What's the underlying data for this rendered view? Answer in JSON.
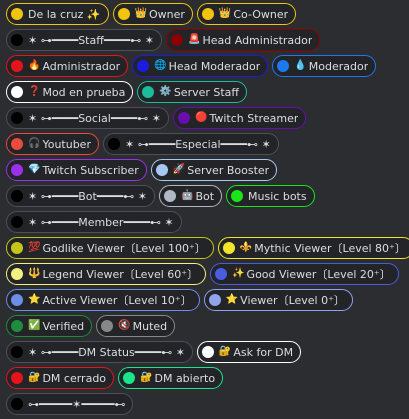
{
  "rows": [
    {
      "roles": [
        {
          "name": "De la cruz ✨",
          "emoji": "",
          "color": "#f1c40f"
        },
        {
          "name": "Owner",
          "emoji": "👑",
          "color": "#f1c40f"
        },
        {
          "name": "Co-Owner",
          "emoji": "👑",
          "color": "#f1c40f"
        }
      ]
    },
    {
      "roles": [
        {
          "name": "✶ ⊶━━━━Staff━━━━⊷ ✶",
          "emoji": "",
          "color": "#000000"
        },
        {
          "name": "Head Administrador",
          "emoji": "🚨",
          "color": "#8b0000"
        }
      ]
    },
    {
      "roles": [
        {
          "name": "Administrador",
          "emoji": "🔥",
          "color": "#e5141b"
        },
        {
          "name": "Head Moderador",
          "emoji": "🌐",
          "color": "#1c1ce0"
        },
        {
          "name": "Moderador",
          "emoji": "💧",
          "color": "#1e78f0"
        }
      ]
    },
    {
      "roles": [
        {
          "name": "Mod en prueba",
          "emoji": "❓",
          "color": "#ffffff"
        },
        {
          "name": "Server Staff",
          "emoji": "⚙️",
          "color": "#1abc9c"
        }
      ]
    },
    {
      "roles": [
        {
          "name": "✶ ⊶━━━━Social━━━━⊷ ✶",
          "emoji": "",
          "color": "#000000"
        },
        {
          "name": "Twitch Streamer",
          "emoji": "🔴",
          "color": "#6a0dad"
        }
      ]
    },
    {
      "roles": [
        {
          "name": "Youtuber",
          "emoji": "🎧",
          "color": "#e74c3c"
        },
        {
          "name": "✶ ⊶━━━━Especial━━━━⊷ ✶",
          "emoji": "",
          "color": "#000000"
        }
      ]
    },
    {
      "roles": [
        {
          "name": "Twitch Subscriber",
          "emoji": "💎",
          "color": "#9b30e8"
        },
        {
          "name": "Server Booster",
          "emoji": "🚀",
          "color": "#a4c8f0"
        }
      ]
    },
    {
      "roles": [
        {
          "name": "✶ ⊶━━━━Bot━━━━⊷ ✶",
          "emoji": "",
          "color": "#000000"
        },
        {
          "name": "Bot",
          "emoji": "🤖",
          "color": "#b0b8c4"
        },
        {
          "name": "Music bots",
          "emoji": "",
          "color": "#19e619"
        }
      ]
    },
    {
      "roles": [
        {
          "name": "✶ ⊶━━━━Member━━━━⊷ ✶",
          "emoji": "",
          "color": "#000000"
        }
      ]
    },
    {
      "roles": [
        {
          "name": "Godlike Viewer〔Level 100⁺〕",
          "emoji": "💯",
          "color": "#c6c61a"
        },
        {
          "name": "Mythic Viewer〔Level 80⁺〕",
          "emoji": "⚜️",
          "color": "#f2e42a"
        }
      ]
    },
    {
      "roles": [
        {
          "name": "Legend Viewer〔Level 60⁺〕",
          "emoji": "🔱",
          "color": "#f4f080"
        },
        {
          "name": "Good Viewer〔Level 20⁺〕",
          "emoji": "✨",
          "color": "#4a5ce0"
        }
      ]
    },
    {
      "roles": [
        {
          "name": "Active Viewer〔Level 10⁺〕",
          "emoji": "⭐",
          "color": "#6c8ee6"
        },
        {
          "name": "Viewer〔Level 0⁺〕",
          "emoji": "⭐",
          "color": "#8fa4ec"
        }
      ]
    },
    {
      "roles": [
        {
          "name": "Verified",
          "emoji": "✅",
          "color": "#1f8b3c"
        },
        {
          "name": "Muted",
          "emoji": "🔇",
          "color": "#888888"
        }
      ]
    },
    {
      "roles": [
        {
          "name": "✶ ⊶━━━━DM Status━━━━⊷ ✶",
          "emoji": "",
          "color": "#000000"
        },
        {
          "name": "Ask for DM",
          "emoji": "🔐",
          "color": "#ffffff"
        }
      ]
    },
    {
      "roles": [
        {
          "name": "DM cerrado",
          "emoji": "🔐",
          "color": "#e5141b"
        },
        {
          "name": "DM abierto",
          "emoji": "🔐",
          "color": "#19e68c"
        }
      ]
    },
    {
      "roles": [
        {
          "name": "⊶━━━━━✶━━━━━⊷",
          "emoji": "",
          "color": "#000000"
        }
      ]
    }
  ]
}
